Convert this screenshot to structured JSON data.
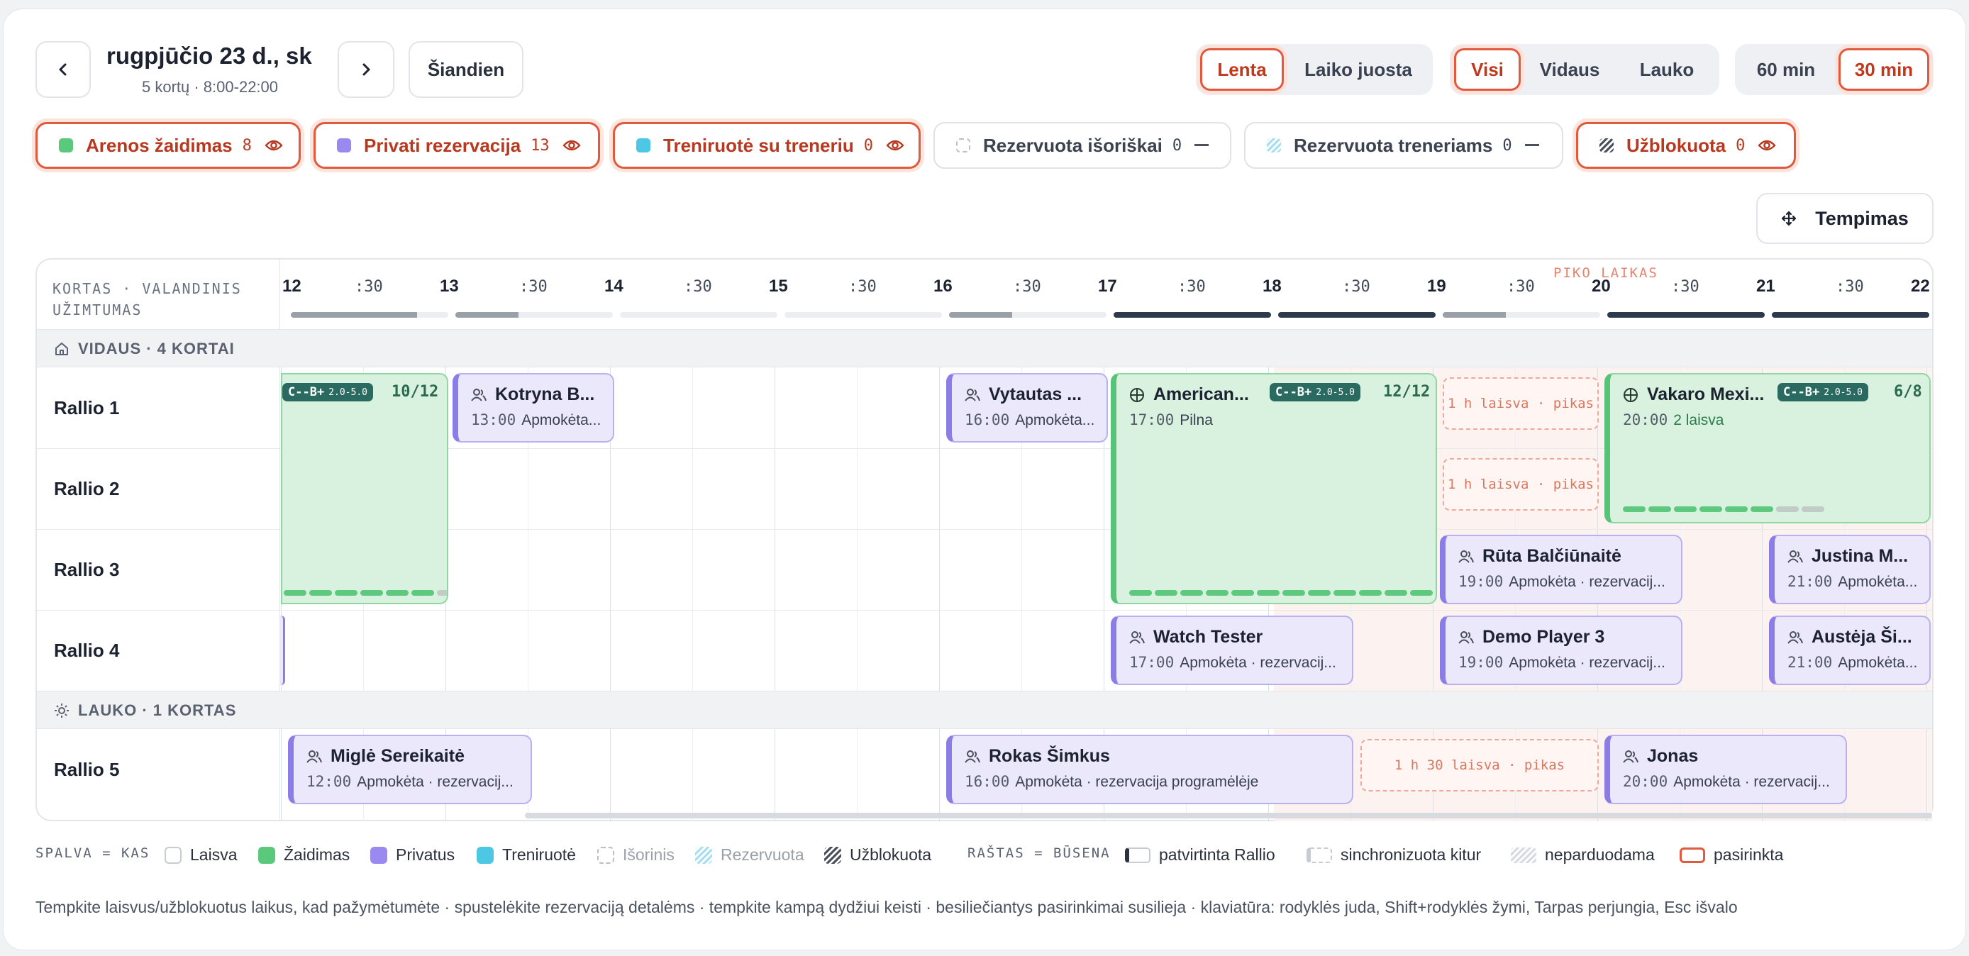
{
  "header": {
    "prev_icon": "chevron-left-icon",
    "next_icon": "chevron-right-icon",
    "date": "rugpjūčio 23 d., sk",
    "subtitle": "5 kortų · 8:00-22:00",
    "today": "Šiandien"
  },
  "view_toggle": [
    {
      "label": "Lenta",
      "active": true
    },
    {
      "label": "Laiko juosta",
      "active": false
    }
  ],
  "filter_toggle": [
    {
      "label": "Visi",
      "active": true
    },
    {
      "label": "Vidaus",
      "active": false
    },
    {
      "label": "Lauko",
      "active": false
    }
  ],
  "slot_toggle": [
    {
      "label": "60 min",
      "active": false
    },
    {
      "label": "30 min",
      "active": true
    }
  ],
  "chips": [
    {
      "label": "Arenos žaidimas",
      "count": "8",
      "color": "#5bc97c",
      "state": "on",
      "action": "eye-icon"
    },
    {
      "label": "Privati rezervacija",
      "count": "13",
      "color": "#9a8af0",
      "state": "on",
      "action": "eye-icon"
    },
    {
      "label": "Treniruotė su treneriu",
      "count": "0",
      "color": "#4cc8e4",
      "state": "on",
      "action": "eye-icon"
    },
    {
      "label": "Rezervuota išoriškai",
      "count": "0",
      "color": "dashed",
      "state": "off",
      "action": "minus-icon"
    },
    {
      "label": "Rezervuota treneriams",
      "count": "0",
      "color": "hatch-blue",
      "state": "off",
      "action": "minus-icon"
    },
    {
      "label": "Užblokuota",
      "count": "0",
      "color": "hatch-dark",
      "state": "on",
      "action": "eye-icon"
    }
  ],
  "drag_button": "Tempimas",
  "grid": {
    "corner_line1": "KORTAS · VALANDINIS",
    "corner_line2": "UŽIMTUMAS",
    "peak_label": "PIKO LAIKAS",
    "hours": [
      "12",
      "13",
      "14",
      "15",
      "16",
      "17",
      "18",
      "19",
      "20",
      "21",
      "22"
    ],
    "half": ":30",
    "occupancy": [
      0.8,
      0.4,
      0,
      0,
      0.4,
      1,
      1,
      0.4,
      1,
      1
    ],
    "sections": [
      {
        "icon": "house-icon",
        "label": "VIDAUS · 4 KORTAI"
      },
      {
        "icon": "sun-icon",
        "label": "LAUKO · 1 KORTAS"
      }
    ],
    "courts": [
      "Rallio 1",
      "Rallio 2",
      "Rallio 3",
      "Rallio 4",
      "Rallio 5"
    ],
    "events": {
      "e1": {
        "level": "C--B+",
        "range": "2.0-5.0",
        "cap": "10/12",
        "filled": 6,
        "total": 8
      },
      "e2": {
        "title": "Kotryna B...",
        "time": "13:00",
        "desc": "Apmokėta..."
      },
      "e3": {
        "title": "Vytautas ...",
        "time": "16:00",
        "desc": "Apmokėta..."
      },
      "e4": {
        "title": "American...",
        "level": "C--B+",
        "range": "2.0-5.0",
        "cap": "12/12",
        "time": "17:00",
        "desc": "Pilna",
        "filled": 12,
        "total": 12
      },
      "e5": {
        "title": "Vakaro Mexi...",
        "level": "C--B+",
        "range": "2.0-5.0",
        "cap": "6/8",
        "time": "20:00",
        "desc": "2 laisva",
        "filled": 6,
        "total": 8
      },
      "e6": {
        "title": "Rūta Balčiūnaitė",
        "time": "19:00",
        "desc": "Apmokėta · rezervacij..."
      },
      "e7": {
        "title": "Justina M...",
        "time": "21:00",
        "desc": "Apmokėta..."
      },
      "e8": {
        "title": "Watch Tester",
        "time": "17:00",
        "desc": "Apmokėta · rezervacij..."
      },
      "e9": {
        "title": "Demo Player 3",
        "time": "19:00",
        "desc": "Apmokėta · rezervacij..."
      },
      "e10": {
        "title": "Austėja Ši...",
        "time": "21:00",
        "desc": "Apmokėta..."
      },
      "e11": {
        "title": "Miglė Sereikaitė",
        "time": "12:00",
        "desc": "Apmokėta · rezervacij..."
      },
      "e12": {
        "title": "Rokas Šimkus",
        "time": "16:00",
        "desc": "Apmokėta · rezervacija programėlėje"
      },
      "e13": {
        "title": "Jonas",
        "time": "20:00",
        "desc": "Apmokėta · rezervacij..."
      }
    },
    "free_slots": {
      "f1": "1 h laisva · pikas",
      "f2": "1 h laisva · pikas",
      "f3": "1 h 30 laisva · pikas"
    }
  },
  "legend": {
    "color_title": "SPALVA = KAS",
    "colors": [
      {
        "label": "Laisva",
        "color": "#ffffff"
      },
      {
        "label": "Žaidimas",
        "color": "#5bc97c"
      },
      {
        "label": "Privatus",
        "color": "#9a8af0"
      },
      {
        "label": "Treniruotė",
        "color": "#4cc8e4"
      },
      {
        "label": "Išorinis",
        "color": "dashed"
      },
      {
        "label": "Rezervuota",
        "color": "hatch-blue"
      },
      {
        "label": "Užblokuota",
        "color": "hatch-dark"
      }
    ],
    "state_title": "RAŠTAS = BŪSENA",
    "states": [
      {
        "label": "patvirtinta Rallio"
      },
      {
        "label": "sinchronizuota kitur"
      },
      {
        "label": "neparduodama"
      },
      {
        "label": "pasirinkta"
      }
    ]
  },
  "footer": "Tempkite laisvus/užblokuotus laikus, kad pažymėtumėte · spustelėkite rezervaciją detalėms · tempkite kampą dydžiui keisti · besiliečiantys pasirinkimai susilieja · klaviatūra: rodyklės juda, Shift+rodyklės žymi, Tarpas perjungia, Esc išvalo"
}
